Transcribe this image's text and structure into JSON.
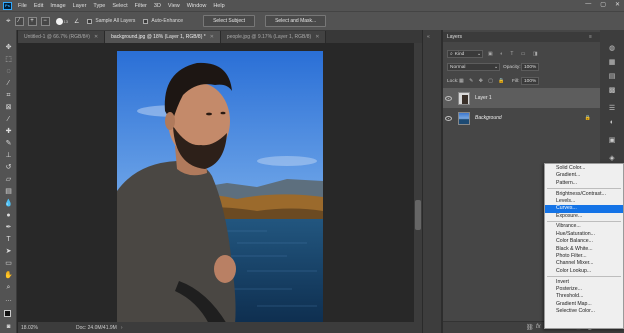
{
  "menubar": {
    "logo": "Ps",
    "items": [
      "File",
      "Edit",
      "Image",
      "Layer",
      "Type",
      "Select",
      "Filter",
      "3D",
      "View",
      "Window",
      "Help"
    ],
    "window_controls": [
      "—",
      "▢",
      "✕"
    ]
  },
  "options": {
    "sample_all_layers": "Sample All Layers",
    "auto_enhance": "Auto-Enhance",
    "select_subject": "Select Subject",
    "select_and_mask": "Select and Mask...",
    "brush_size": "13"
  },
  "tabs": [
    {
      "label": "Untitled-1 @ 66.7% (RGB/8#)",
      "active": false
    },
    {
      "label": "background.jpg @ 18% (Layer 1, RGB/8) *",
      "active": true
    },
    {
      "label": "people.jpg @ 9.17% (Layer 1, RGB/8)",
      "active": false
    }
  ],
  "status": {
    "zoom": "18.02%",
    "doc": "Doc: 24.0M/41.9M"
  },
  "layers_panel": {
    "title": "Layers",
    "kind": "Kind",
    "blend_mode": "Normal",
    "opacity_label": "Opacity:",
    "opacity_value": "100%",
    "lock_label": "Lock:",
    "fill_label": "Fill:",
    "fill_value": "100%",
    "layers": [
      {
        "name": "Layer 1",
        "selected": true
      },
      {
        "name": "Background",
        "selected": false
      }
    ]
  },
  "adjustment_menu": {
    "groups": [
      [
        "Solid Color...",
        "Gradient...",
        "Pattern..."
      ],
      [
        "Brightness/Contrast...",
        "Levels...",
        "Curves...",
        "Exposure..."
      ],
      [
        "Vibrance...",
        "Hue/Saturation...",
        "Color Balance...",
        "Black & White...",
        "Photo Filter...",
        "Channel Mixer...",
        "Color Lookup..."
      ],
      [
        "Invert",
        "Posterize...",
        "Threshold...",
        "Gradient Map...",
        "Selective Color..."
      ]
    ],
    "highlighted": "Curves..."
  },
  "colors": {
    "accent": "#1473e6",
    "chrome": "#535353",
    "canvas_bg": "#282828"
  }
}
